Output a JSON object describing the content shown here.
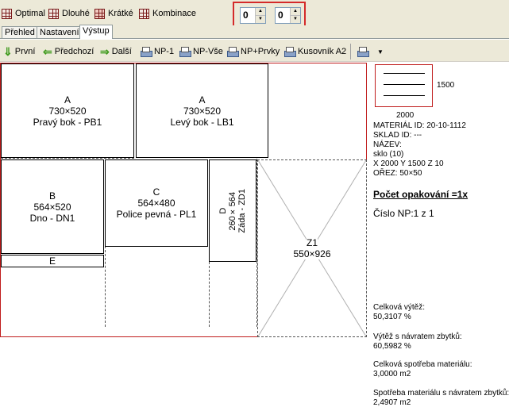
{
  "toolbar": {
    "optimal": "Optimal",
    "dlouhe": "Dlouhé",
    "kratke": "Krátké",
    "kombinace": "Kombinace",
    "spin1": "0",
    "spin2": "0"
  },
  "tabs": [
    "Přehled",
    "Nastavení",
    "Výstup"
  ],
  "nav": {
    "prvni": "První",
    "predchozi": "Předchozí",
    "dalsi": "Další",
    "np1": "NP-1",
    "npvse": "NP-Vše",
    "npprvky": "NP+Prvky",
    "kusovnik": "Kusovník A2"
  },
  "parts": [
    {
      "letter": "A",
      "size": "730×520",
      "name": "Pravý bok - PB1"
    },
    {
      "letter": "A",
      "size": "730×520",
      "name": "Levý bok - LB1"
    },
    {
      "letter": "B",
      "size": "564×520",
      "name": "Dno - DN1"
    },
    {
      "letter": "C",
      "size": "564×480",
      "name": "Police pevná - PL1"
    },
    {
      "letter": "D",
      "size": "260×564",
      "name": "Záda - ZD1"
    },
    {
      "letter": "Z1",
      "size": "550×926"
    },
    {
      "letter": "E"
    }
  ],
  "panel": {
    "preview_height": "1500",
    "preview_width": "2000",
    "material_id": "MATERIÁL ID:  20-10-1112",
    "sklad_id": "SKLAD ID:      ---",
    "nazev": "NÁZEV:",
    "nazev_val": "sklo (10)",
    "xyz": "X 2000  Y 1500  Z 10",
    "orez": "OŘEZ:     50×50",
    "pocet": "Počet opakování =1x",
    "cislo": "Číslo NP:1 z 1",
    "celkova_vytez_label": "Celková výtěž:",
    "celkova_vytez": "50,3107 %",
    "vytez_zbytky_label": "Výtěž s návratem zbytků:",
    "vytez_zbytky": "60,5982 %",
    "spotreba_label": "Celková spotřeba materiálu:",
    "spotreba": "3,0000 m2",
    "spotreba_zbytky_label": "Spotřeba materiálu s návratem zbytků:",
    "spotreba_zbytky": "2,4907 m2"
  }
}
